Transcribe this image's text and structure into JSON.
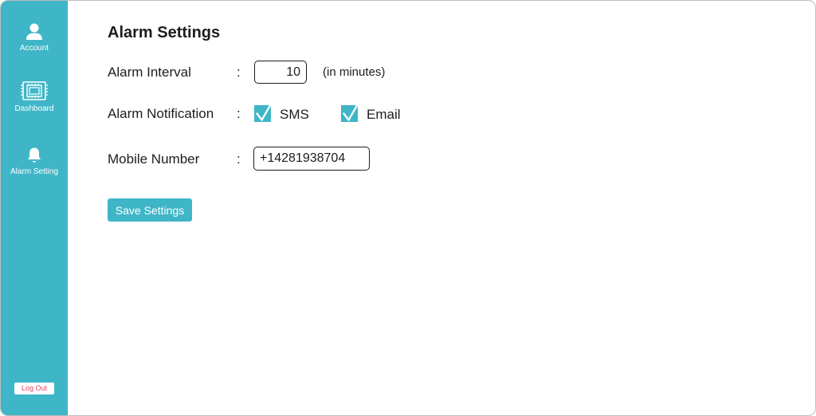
{
  "sidebar": {
    "items": [
      {
        "label": "Account",
        "icon": "user-icon"
      },
      {
        "label": "Dashboard",
        "icon": "dashboard-chip-icon"
      },
      {
        "label": "Alarm Setting",
        "icon": "bell-icon"
      }
    ],
    "logout_label": "Log Out"
  },
  "main": {
    "title": "Alarm Settings",
    "alarm_interval": {
      "label": "Alarm Interval",
      "colon": ":",
      "value": "10",
      "unit": "(in minutes)"
    },
    "alarm_notification": {
      "label": "Alarm Notification",
      "colon": ":",
      "options": [
        {
          "label": "SMS",
          "checked": true
        },
        {
          "label": "Email",
          "checked": true
        }
      ]
    },
    "mobile_number": {
      "label": "Mobile Number",
      "colon": ":",
      "value": "+14281938704"
    },
    "save_label": "Save Settings"
  },
  "colors": {
    "accent": "#3fb6c7",
    "logout_text": "#e0455f",
    "text": "#1d1d1d"
  }
}
